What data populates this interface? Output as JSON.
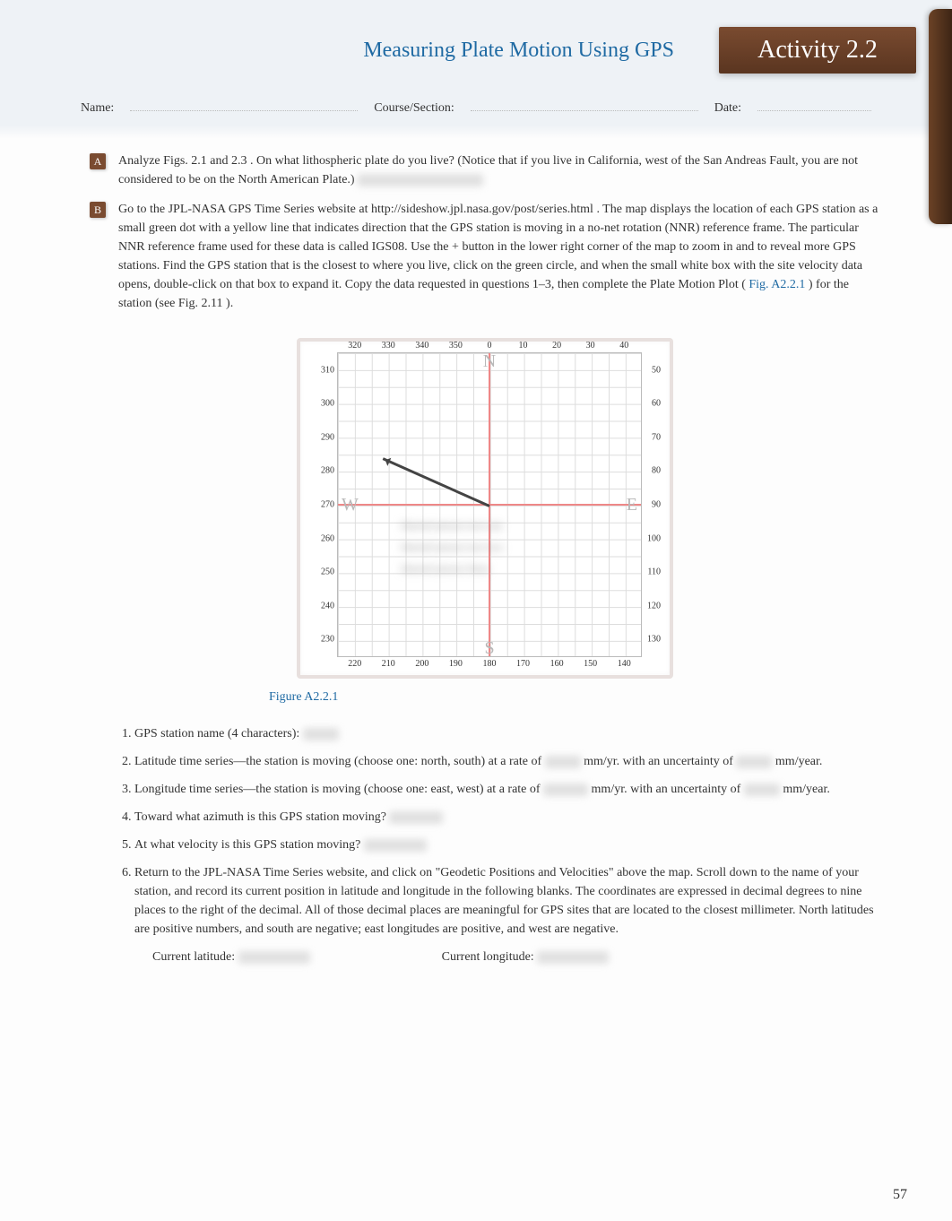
{
  "header": {
    "title": "Measuring Plate Motion Using GPS",
    "activity_label": "Activity 2.2"
  },
  "name_row": {
    "name_label": "Name:",
    "course_label": "Course/Section:",
    "date_label": "Date:"
  },
  "sectionA": {
    "badge": "A",
    "text_pre": "Analyze",
    "ref1": "Figs. 2.1",
    "and": "and",
    "ref2": "2.3",
    "text_post": ". On what lithospheric plate do you live? (Notice that if you live in California, west of the San Andreas Fault, you are not considered to be on the North American Plate.)"
  },
  "sectionB": {
    "badge": "B",
    "t1": "Go to the JPL-NASA GPS Time Series website at ",
    "url": "http://sideshow.jpl.nasa.gov/post/series.html",
    "t2": ". The map displays the location of each GPS station as a small green dot with a yellow line that indicates direction that the GPS station is moving in a no-net rotation (NNR) reference frame. The particular NNR reference frame used for these data is called IGS08. Use the ",
    "plus": "+",
    "t3": " button in the lower right corner of the map to zoom in and to reveal more GPS stations. Find the GPS station that is the closest to where you live, click on the green circle, and when the small white box with the site velocity data opens, double-click on that box to expand it. Copy the data requested in questions 1–3, then complete the Plate Motion Plot (",
    "figref": "Fig. A2.2.1",
    "t4": ") for the station (see ",
    "figref2": "Fig. 2.11",
    "t5": ")."
  },
  "grid": {
    "N": "N",
    "S": "S",
    "E": "E",
    "W": "W",
    "top": [
      "320",
      "330",
      "340",
      "350",
      "0",
      "10",
      "20",
      "30",
      "40"
    ],
    "right": [
      "50",
      "60",
      "70",
      "80",
      "90",
      "100",
      "110",
      "120",
      "130"
    ],
    "bottom": [
      "220",
      "210",
      "200",
      "190",
      "180",
      "170",
      "160",
      "150",
      "140"
    ],
    "left": [
      "310",
      "300",
      "290",
      "280",
      "270",
      "260",
      "250",
      "240",
      "230"
    ]
  },
  "fig_label": "Figure A2.2.1",
  "questions": {
    "q1": "GPS station name (4 characters):",
    "q2a": "Latitude time series—the station is moving (choose one: north, south) at a rate of",
    "q2b": "mm/yr. with an uncertainty of",
    "q2c": "mm/year.",
    "q3a": "Longitude time series—the station is moving (choose one: east, west) at a rate of",
    "q3b": "mm/yr. with an uncertainty of",
    "q3c": "mm/year.",
    "q4": "Toward what azimuth is this GPS station moving?",
    "q5": "At what velocity is this GPS station moving?",
    "q6": "Return to the JPL-NASA Time Series website, and click on \"Geodetic Positions and Velocities\" above the map. Scroll down to the name of your station, and record its current position in latitude and longitude in the following blanks. The coordinates are expressed in decimal degrees to nine places to the right of the decimal. All of those decimal places are meaningful for GPS sites that are located to the closest millimeter. North latitudes are positive numbers, and south are negative; east longitudes are positive, and west are negative.",
    "curr_lat": "Current latitude:",
    "curr_lon": "Current longitude:"
  },
  "blur_lines": {
    "l1": "blurred answer text one",
    "l2": "blurred answer text two",
    "l3": "blurred answer three"
  },
  "page_num": "57"
}
